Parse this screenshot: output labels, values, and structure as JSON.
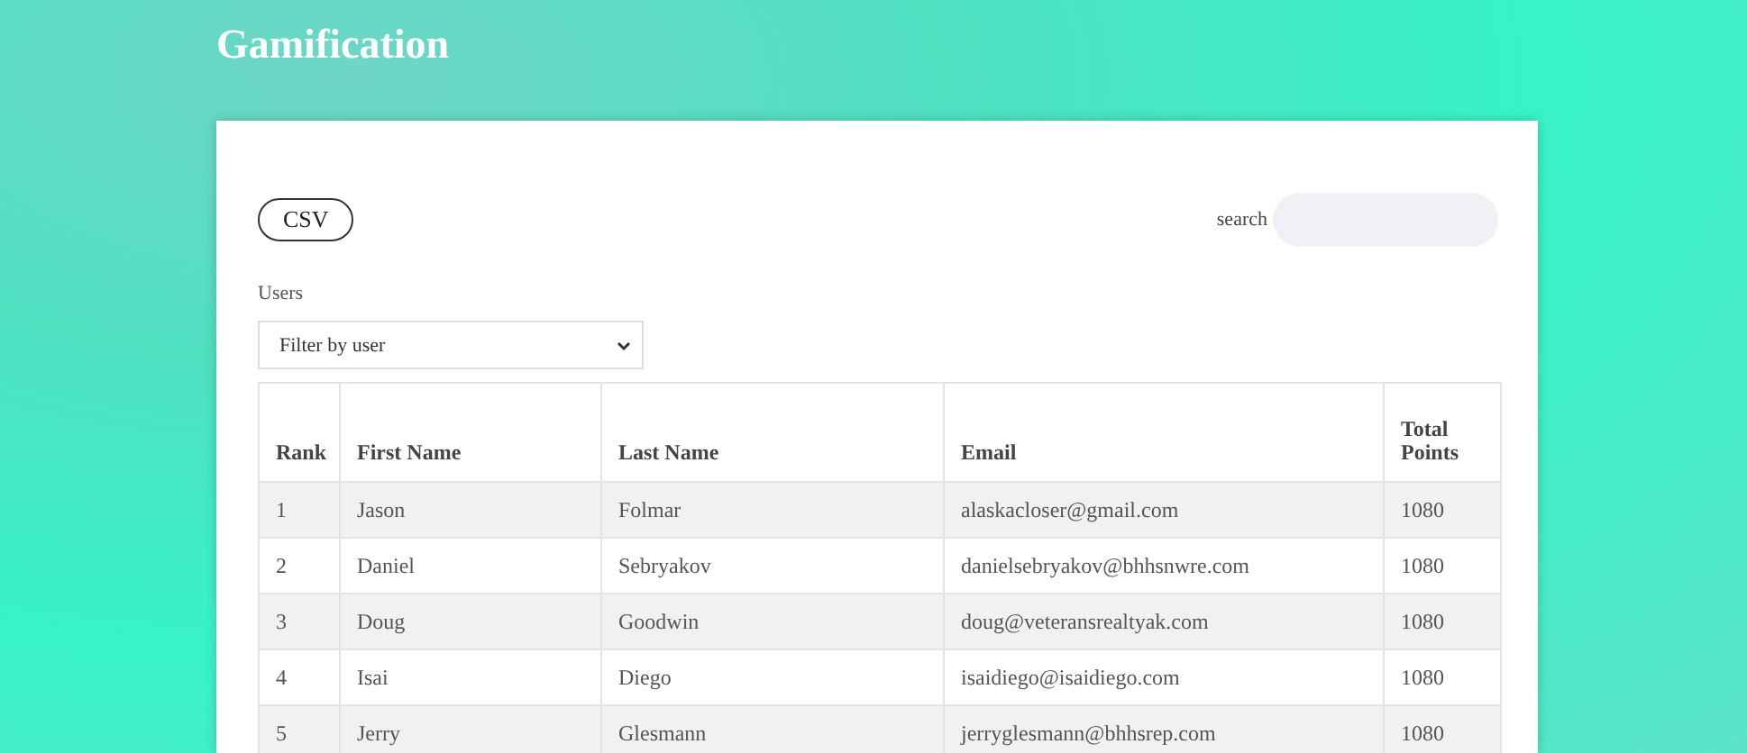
{
  "title": "Gamification",
  "toolbar": {
    "csv_button": "CSV",
    "search_label": "search"
  },
  "filter": {
    "label": "Users",
    "value": "Filter by user"
  },
  "table": {
    "columns": [
      "Rank",
      "First Name",
      "Last Name",
      "Email",
      "Total Points"
    ],
    "rows": [
      [
        "1",
        "Jason",
        "Folmar",
        "alaskacloser@gmail.com",
        "1080"
      ],
      [
        "2",
        "Daniel",
        "Sebryakov",
        "danielsebryakov@bhhsnwre.com",
        "1080"
      ],
      [
        "3",
        "Doug",
        "Goodwin",
        "doug@veteransrealtyak.com",
        "1080"
      ],
      [
        "4",
        "Isai",
        "Diego",
        "isaidiego@isaidiego.com",
        "1080"
      ],
      [
        "5",
        "Jerry",
        "Glesmann",
        "jerryglesmann@bhhsrep.com",
        "1080"
      ]
    ]
  }
}
